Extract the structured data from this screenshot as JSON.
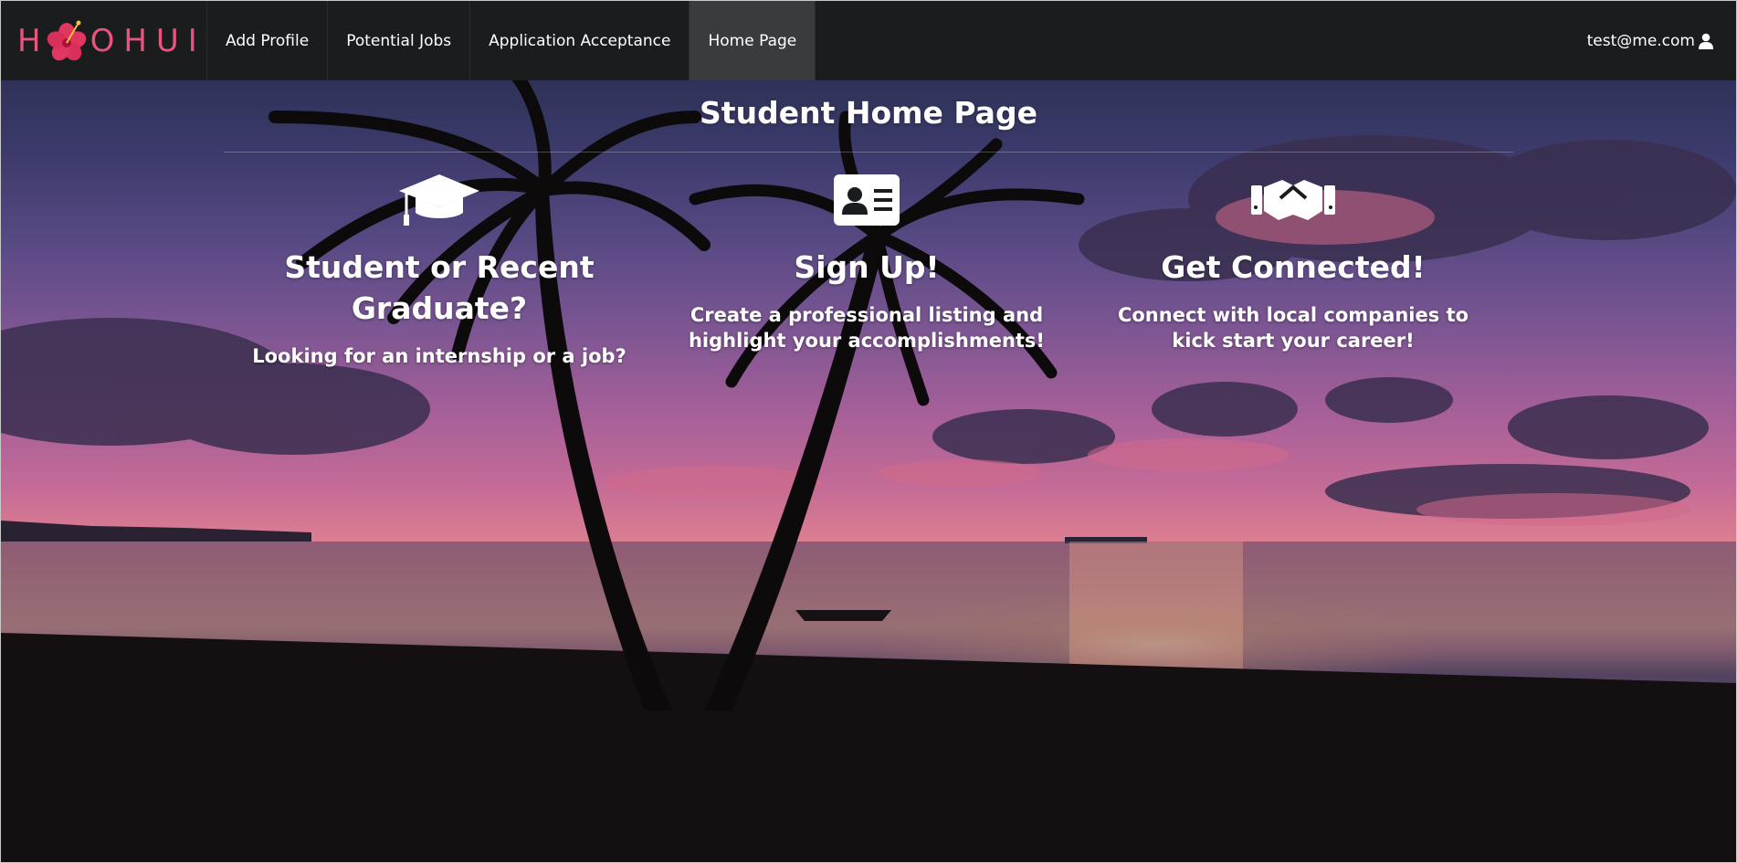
{
  "navbar": {
    "brand": "HOHUI",
    "brand_color": "#e8547e",
    "brand_icon": "hibiscus-flower-icon",
    "items": [
      {
        "label": "Add Profile",
        "active": false
      },
      {
        "label": "Potential Jobs",
        "active": false
      },
      {
        "label": "Application Acceptance",
        "active": false
      },
      {
        "label": "Home Page",
        "active": true
      }
    ],
    "user": {
      "email": "test@me.com",
      "icon": "user-icon"
    }
  },
  "main": {
    "title": "Student Home Page",
    "columns": [
      {
        "icon": "graduation-cap-icon",
        "heading": "Student or Recent Graduate?",
        "text": "Looking for an internship or a job?"
      },
      {
        "icon": "id-card-icon",
        "heading": "Sign Up!",
        "text": "Create a professional listing and highlight your accomplishments!"
      },
      {
        "icon": "handshake-icon",
        "heading": "Get Connected!",
        "text": "Connect with local companies to kick start your career!"
      }
    ]
  },
  "background": {
    "description_icon": "sunset-beach-palm-background",
    "accent_colors": [
      "#2f3258",
      "#a45f98",
      "#ee9a8c",
      "#0d0b0d"
    ]
  }
}
